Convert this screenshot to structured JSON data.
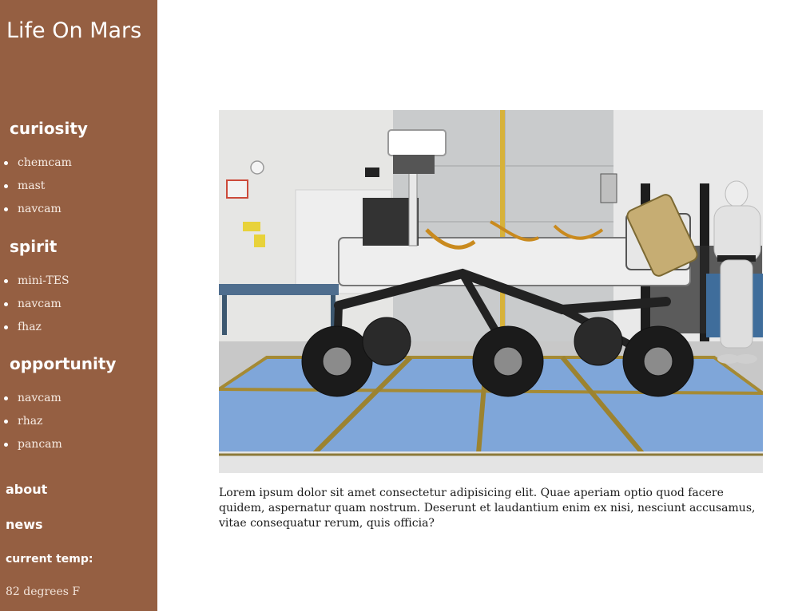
{
  "site": {
    "title": "Life On Mars"
  },
  "sections": [
    {
      "title": "curiosity",
      "items": [
        "chemcam",
        "mast",
        "navcam"
      ]
    },
    {
      "title": "spirit",
      "items": [
        "mini-TES",
        "navcam",
        "fhaz"
      ]
    },
    {
      "title": "opportunity",
      "items": [
        "navcam",
        "rhaz",
        "pancam"
      ]
    }
  ],
  "nav": {
    "about": "about",
    "news": "news"
  },
  "temperature": {
    "label": "current temp:",
    "value": "82 degrees F"
  },
  "main": {
    "caption": "Lorem ipsum dolor sit amet consectetur adipisicing elit. Quae aperiam optio quod facere quidem, aspernatur quam nostrum. Deserunt et laudantium enim ex nisi, nesciunt accusamus, vitae consequatur rerum, quis officia?"
  },
  "colors": {
    "sidebar": "#955f42",
    "floor": "#7fa6d9"
  }
}
